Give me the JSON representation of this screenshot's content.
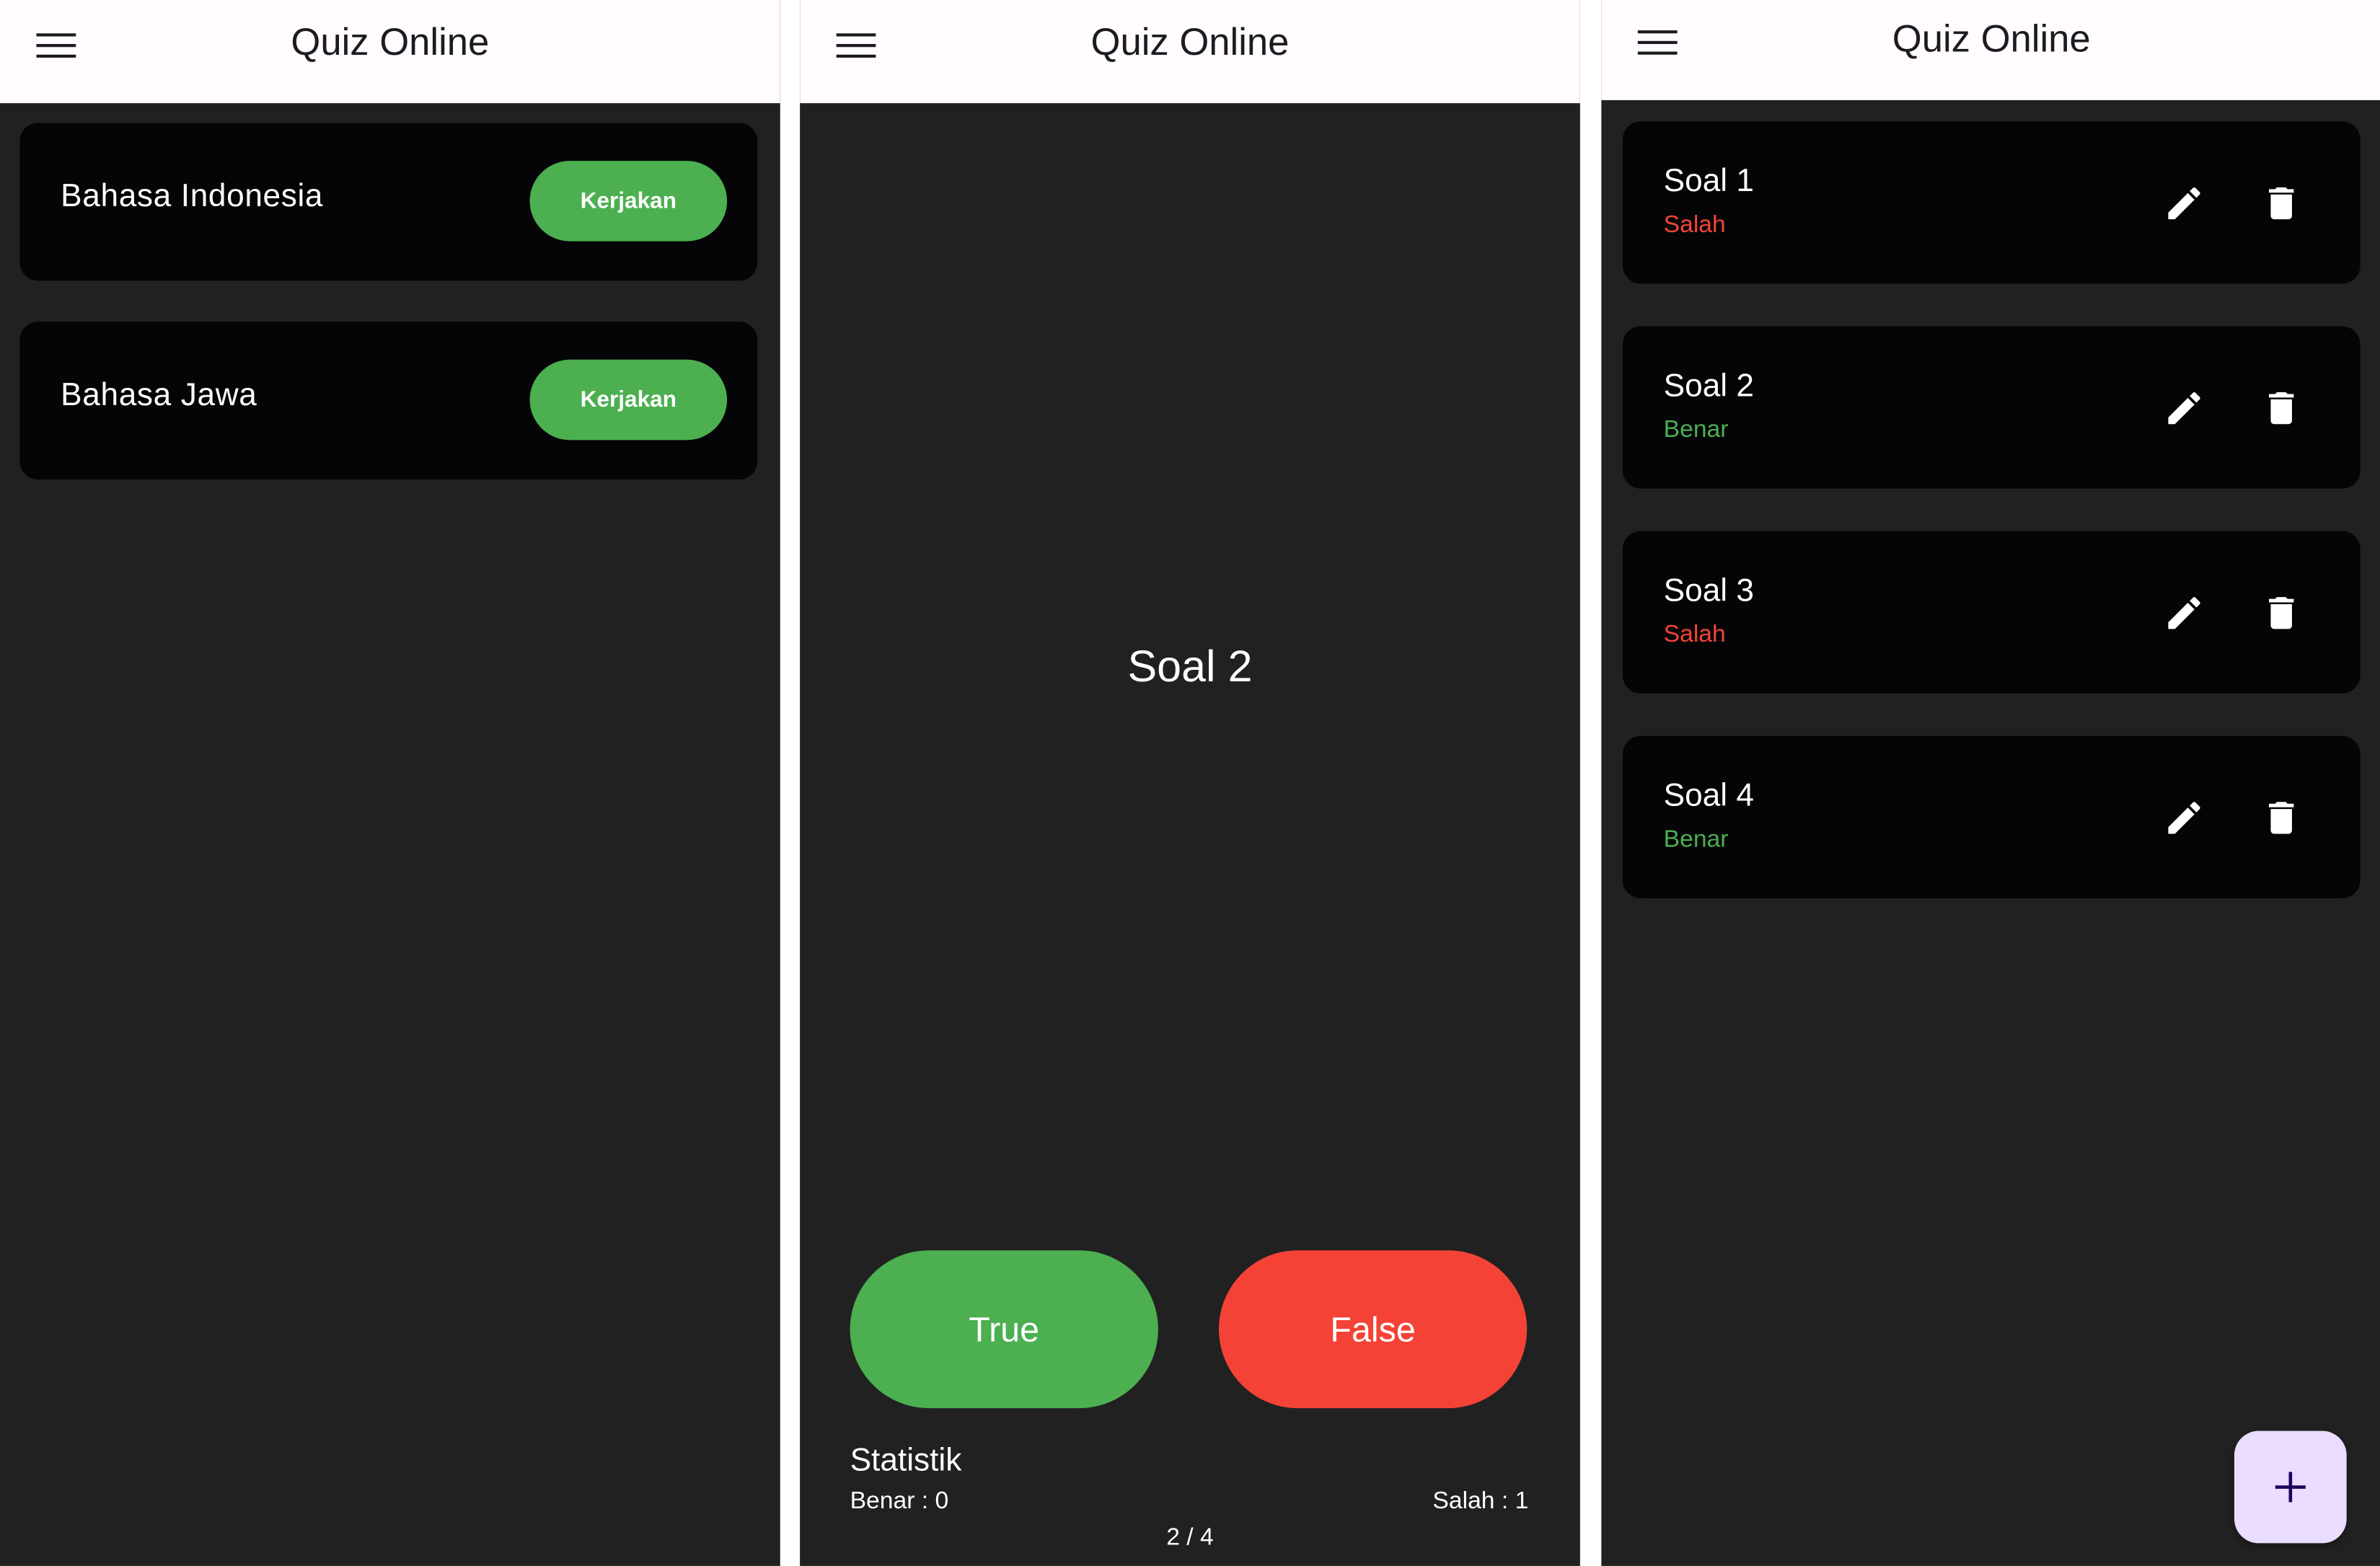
{
  "colors": {
    "appbar_bg": "#fffbfe",
    "screen_bg": "#212121",
    "card_bg": "#050508",
    "green": "#4caf50",
    "red": "#f44336",
    "fab_bg": "#eaddff"
  },
  "screens": [
    {
      "title": "Quiz Online",
      "menu_icon": "menu-icon",
      "quizzes": [
        {
          "label": "Bahasa Indonesia",
          "button": "Kerjakan"
        },
        {
          "label": "Bahasa Jawa",
          "button": "Kerjakan"
        }
      ]
    },
    {
      "title": "Quiz Online",
      "menu_icon": "menu-icon",
      "question": "Soal 2",
      "true_label": "True",
      "false_label": "False",
      "stats": {
        "title": "Statistik",
        "benar": "Benar : 0",
        "salah": "Salah : 1"
      },
      "progress": "2 / 4"
    },
    {
      "title": "Quiz Online",
      "menu_icon": "menu-icon",
      "questions": [
        {
          "title": "Soal 1",
          "status": "Salah",
          "edit_icon": "edit-icon",
          "delete_icon": "delete-icon"
        },
        {
          "title": "Soal 2",
          "status": "Benar",
          "edit_icon": "edit-icon",
          "delete_icon": "delete-icon"
        },
        {
          "title": "Soal 3",
          "status": "Salah",
          "edit_icon": "edit-icon",
          "delete_icon": "delete-icon"
        },
        {
          "title": "Soal 4",
          "status": "Benar",
          "edit_icon": "edit-icon",
          "delete_icon": "delete-icon"
        }
      ],
      "fab_icon": "add-icon"
    }
  ]
}
